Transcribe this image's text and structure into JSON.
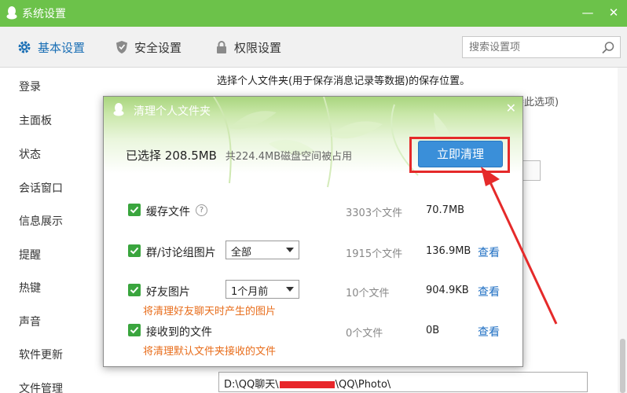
{
  "window": {
    "title": "系统设置",
    "minimize": "—",
    "close": "✕"
  },
  "toolbar": {
    "tabs": [
      {
        "label": "基本设置",
        "icon": "gear-icon"
      },
      {
        "label": "安全设置",
        "icon": "shield-icon"
      },
      {
        "label": "权限设置",
        "icon": "lock-icon"
      }
    ],
    "search_placeholder": "搜索设置项"
  },
  "sidebar": {
    "items": [
      "登录",
      "主面板",
      "状态",
      "会话窗口",
      "信息展示",
      "提醒",
      "热键",
      "声音",
      "软件更新",
      "文件管理"
    ]
  },
  "content": {
    "description": "选择个人文件夹(用于保存消息记录等数据)的保存位置。",
    "behind_text": "持此选项)",
    "path_prefix": "D:\\QQ聊天\\",
    "path_suffix": "\\QQ\\Photo\\"
  },
  "dialog": {
    "title": "清理个人文件夹",
    "close": "✕",
    "selected_label": "已选择",
    "selected_size": "208.5MB",
    "total_text": "共224.4MB磁盘空间被占用",
    "clean_button": "立即清理",
    "rows": [
      {
        "label": "缓存文件",
        "count": "3303个文件",
        "size": "70.7MB",
        "help": "?"
      },
      {
        "label": "群/讨论组图片",
        "select": "全部",
        "count": "1915个文件",
        "size": "136.9MB",
        "view": "查看"
      },
      {
        "label": "好友图片",
        "select": "1个月前",
        "note": "将清理好友聊天时产生的图片",
        "count": "10个文件",
        "size": "904.9KB",
        "view": "查看"
      },
      {
        "label": "接收到的文件",
        "note": "将清理默认文件夹接收的文件",
        "count": "0个文件",
        "size": "0B",
        "view": "查看"
      }
    ]
  },
  "colors": {
    "titlebar": "#6cc24a",
    "accent": "#3a8fd9",
    "highlight": "#e52a2a",
    "note": "#e86d1b",
    "link": "#1f6fc3"
  }
}
